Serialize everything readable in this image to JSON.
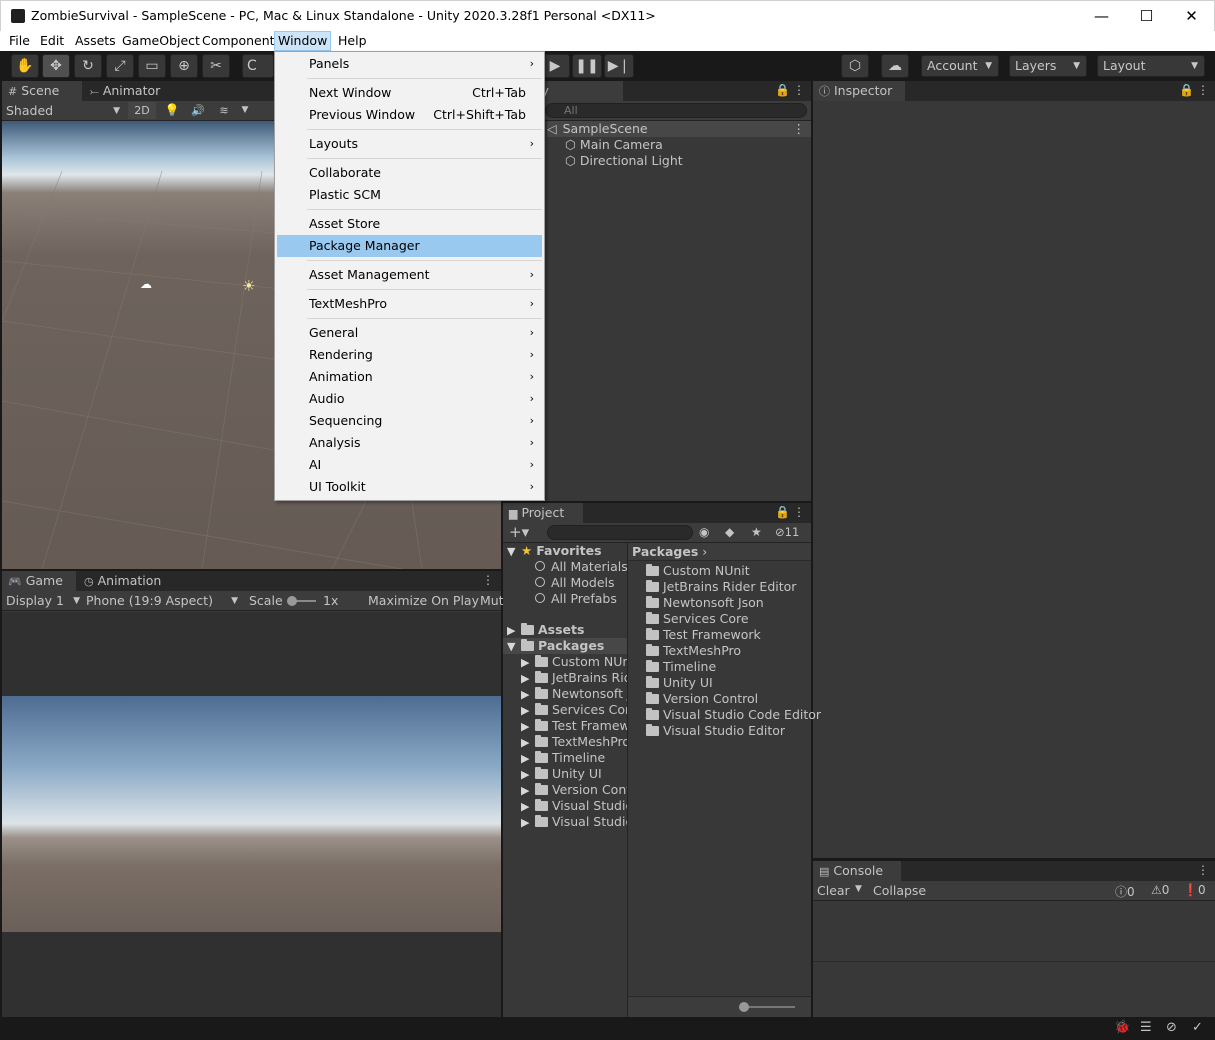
{
  "window": {
    "title": "ZombieSurvival - SampleScene - PC, Mac & Linux Standalone - Unity 2020.3.28f1 Personal <DX11>",
    "minimize": "—",
    "maximize": "☐",
    "close": "✕"
  },
  "menubar": [
    "File",
    "Edit",
    "Assets",
    "GameObject",
    "Component",
    "Window",
    "Help"
  ],
  "toolbar": {
    "account": "Account",
    "layers": "Layers",
    "layout": "Layout",
    "collab_stub": "C"
  },
  "window_menu": {
    "groups": [
      [
        {
          "label": "Panels",
          "submenu": true
        }
      ],
      [
        {
          "label": "Next Window",
          "shortcut": "Ctrl+Tab"
        },
        {
          "label": "Previous Window",
          "shortcut": "Ctrl+Shift+Tab"
        }
      ],
      [
        {
          "label": "Layouts",
          "submenu": true
        }
      ],
      [
        {
          "label": "Collaborate"
        },
        {
          "label": "Plastic SCM"
        }
      ],
      [
        {
          "label": "Asset Store"
        },
        {
          "label": "Package Manager",
          "highlighted": true
        }
      ],
      [
        {
          "label": "Asset Management",
          "submenu": true
        }
      ],
      [
        {
          "label": "TextMeshPro",
          "submenu": true
        }
      ],
      [
        {
          "label": "General",
          "submenu": true
        },
        {
          "label": "Rendering",
          "submenu": true
        },
        {
          "label": "Animation",
          "submenu": true
        },
        {
          "label": "Audio",
          "submenu": true
        },
        {
          "label": "Sequencing",
          "submenu": true
        },
        {
          "label": "Analysis",
          "submenu": true
        },
        {
          "label": "AI",
          "submenu": true
        },
        {
          "label": "UI Toolkit",
          "submenu": true
        }
      ]
    ]
  },
  "scene": {
    "tab": "Scene",
    "tab2": "Animator",
    "shading": "Shaded",
    "mode2d": "2D"
  },
  "hierarchy": {
    "tab": "Hierarchy",
    "tab_visible": "rarchy",
    "search_placeholder": "All",
    "scene": "SampleScene",
    "objects": [
      "Main Camera",
      "Directional Light"
    ]
  },
  "inspector": {
    "tab": "Inspector"
  },
  "game": {
    "tab": "Game",
    "tab2": "Animation",
    "display": "Display 1",
    "aspect": "Phone (19:9 Aspect)",
    "scale_label": "Scale",
    "scale_value": "1x",
    "maximize": "Maximize On Play",
    "mute": "Mut"
  },
  "project": {
    "tab": "Project",
    "hidden_count": "11",
    "favorites": "Favorites",
    "fav_items": [
      "All Materials",
      "All Models",
      "All Prefabs"
    ],
    "assets": "Assets",
    "packages": "Packages",
    "tree_packages": [
      "Custom NUni",
      "JetBrains Rid",
      "Newtonsoft J",
      "Services Core",
      "Test Framew",
      "TextMeshPro",
      "Timeline",
      "Unity UI",
      "Version Contr",
      "Visual Studio",
      "Visual Studio"
    ],
    "breadcrumb": "Packages",
    "list": [
      "Custom NUnit",
      "JetBrains Rider Editor",
      "Newtonsoft Json",
      "Services Core",
      "Test Framework",
      "TextMeshPro",
      "Timeline",
      "Unity UI",
      "Version Control",
      "Visual Studio Code Editor",
      "Visual Studio Editor"
    ]
  },
  "console": {
    "tab": "Console",
    "clear": "Clear",
    "collapse": "Collapse",
    "log_count": "0",
    "warn_count": "0",
    "error_count": "0"
  }
}
